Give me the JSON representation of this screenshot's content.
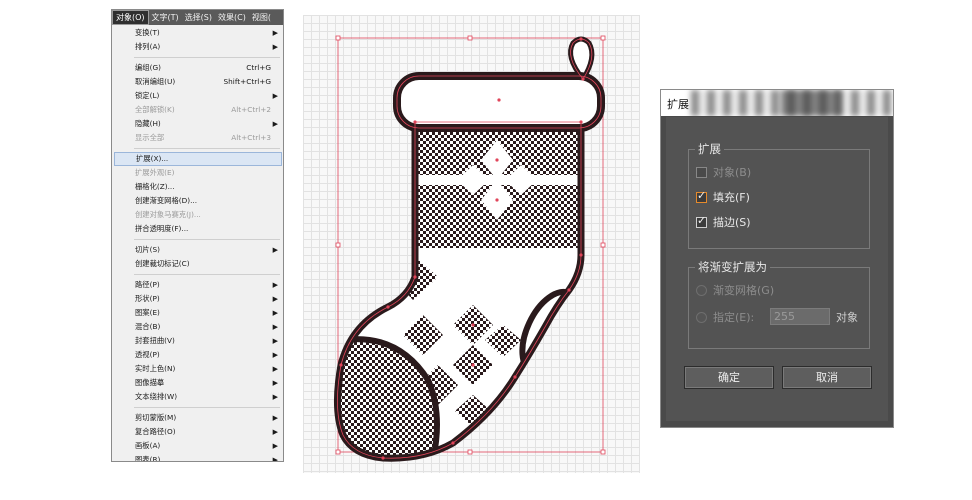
{
  "menubar": {
    "items": [
      "对象(O)",
      "文字(T)",
      "选择(S)",
      "效果(C)",
      "视图("
    ],
    "active_index": 0
  },
  "menu": {
    "items": [
      {
        "label": "变换(T)",
        "shortcut": "",
        "submenu": true,
        "disabled": false
      },
      {
        "label": "排列(A)",
        "shortcut": "",
        "submenu": true,
        "disabled": false
      },
      {
        "sep": true
      },
      {
        "label": "编组(G)",
        "shortcut": "Ctrl+G",
        "submenu": false,
        "disabled": false
      },
      {
        "label": "取消编组(U)",
        "shortcut": "Shift+Ctrl+G",
        "submenu": false,
        "disabled": false
      },
      {
        "label": "锁定(L)",
        "shortcut": "",
        "submenu": true,
        "disabled": false
      },
      {
        "label": "全部解锁(K)",
        "shortcut": "Alt+Ctrl+2",
        "submenu": false,
        "disabled": true
      },
      {
        "label": "隐藏(H)",
        "shortcut": "",
        "submenu": true,
        "disabled": false
      },
      {
        "label": "显示全部",
        "shortcut": "Alt+Ctrl+3",
        "submenu": false,
        "disabled": true
      },
      {
        "sep": true
      },
      {
        "label": "扩展(X)...",
        "shortcut": "",
        "submenu": false,
        "disabled": false,
        "highlighted": true
      },
      {
        "label": "扩展外观(E)",
        "shortcut": "",
        "submenu": false,
        "disabled": true
      },
      {
        "label": "栅格化(Z)...",
        "shortcut": "",
        "submenu": false,
        "disabled": false
      },
      {
        "label": "创建渐变网格(D)...",
        "shortcut": "",
        "submenu": false,
        "disabled": false
      },
      {
        "label": "创建对象马赛克(J)...",
        "shortcut": "",
        "submenu": false,
        "disabled": true
      },
      {
        "label": "拼合透明度(F)...",
        "shortcut": "",
        "submenu": false,
        "disabled": false
      },
      {
        "sep": true
      },
      {
        "label": "切片(S)",
        "shortcut": "",
        "submenu": true,
        "disabled": false
      },
      {
        "label": "创建裁切标记(C)",
        "shortcut": "",
        "submenu": false,
        "disabled": false
      },
      {
        "sep": true
      },
      {
        "label": "路径(P)",
        "shortcut": "",
        "submenu": true,
        "disabled": false
      },
      {
        "label": "形状(P)",
        "shortcut": "",
        "submenu": true,
        "disabled": false
      },
      {
        "label": "图案(E)",
        "shortcut": "",
        "submenu": true,
        "disabled": false
      },
      {
        "label": "混合(B)",
        "shortcut": "",
        "submenu": true,
        "disabled": false
      },
      {
        "label": "封套扭曲(V)",
        "shortcut": "",
        "submenu": true,
        "disabled": false
      },
      {
        "label": "透视(P)",
        "shortcut": "",
        "submenu": true,
        "disabled": false
      },
      {
        "label": "实时上色(N)",
        "shortcut": "",
        "submenu": true,
        "disabled": false
      },
      {
        "label": "图像描摹",
        "shortcut": "",
        "submenu": true,
        "disabled": false
      },
      {
        "label": "文本绕排(W)",
        "shortcut": "",
        "submenu": true,
        "disabled": false
      },
      {
        "sep": true
      },
      {
        "label": "剪切蒙版(M)",
        "shortcut": "",
        "submenu": true,
        "disabled": false
      },
      {
        "label": "复合路径(O)",
        "shortcut": "",
        "submenu": true,
        "disabled": false
      },
      {
        "label": "画板(A)",
        "shortcut": "",
        "submenu": true,
        "disabled": false
      },
      {
        "label": "图表(R)",
        "shortcut": "",
        "submenu": true,
        "disabled": false
      }
    ]
  },
  "dialog": {
    "title": "扩展",
    "expand_group": {
      "title": "扩展",
      "object": {
        "label": "对象(B)",
        "checked": false,
        "disabled": true
      },
      "fill": {
        "label": "填充(F)",
        "checked": true,
        "disabled": false
      },
      "stroke": {
        "label": "描边(S)",
        "checked": true,
        "disabled": false
      }
    },
    "gradient_group": {
      "title": "将渐变扩展为",
      "gradient_mesh": {
        "label": "渐变网格(G)",
        "disabled": true
      },
      "specify": {
        "label": "指定(E):",
        "value": "255",
        "unit": "对象",
        "disabled": true
      }
    },
    "ok_label": "确定",
    "cancel_label": "取消"
  },
  "colors": {
    "menu_highlight": "#dbe6f4",
    "dialog_bg": "#535353",
    "focus_orange": "#e58a2c",
    "path_red": "#e0455a"
  }
}
